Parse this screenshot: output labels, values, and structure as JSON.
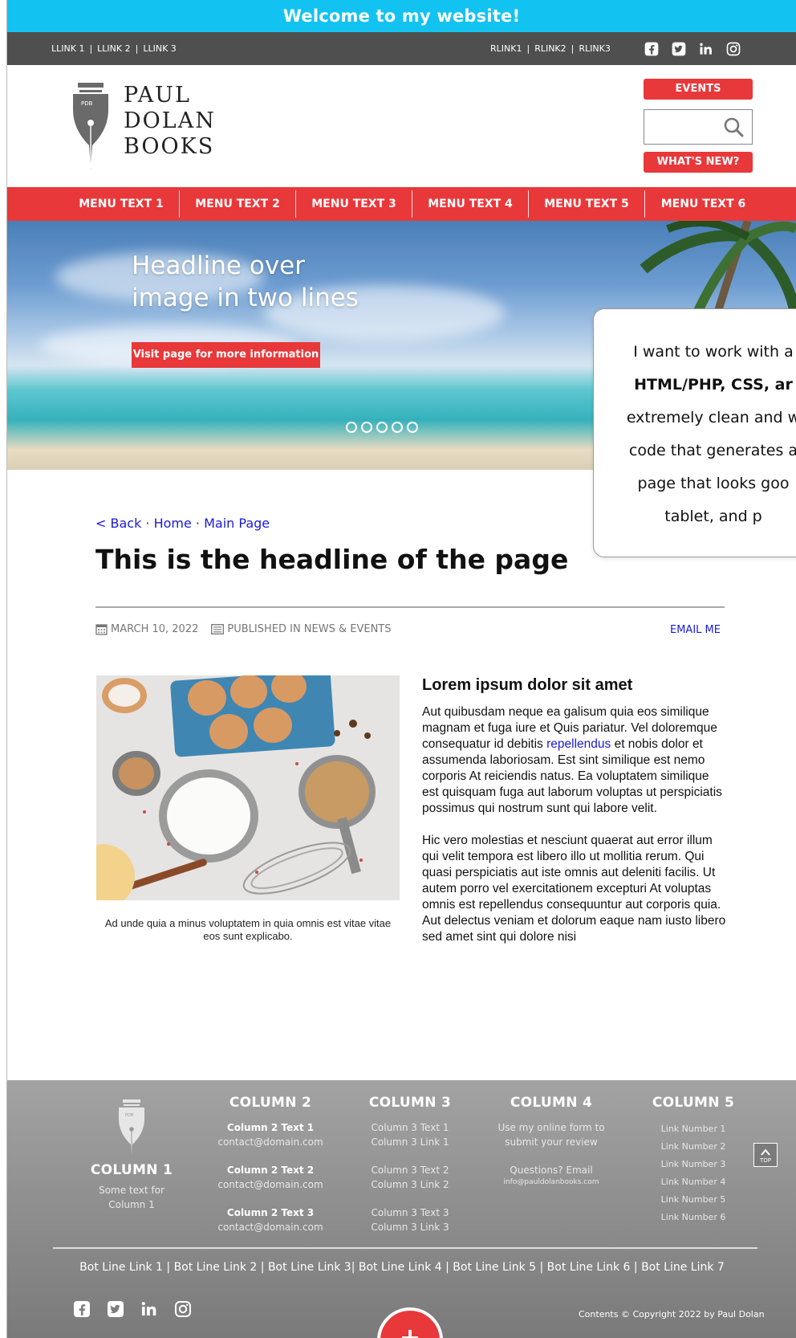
{
  "welcome": {
    "text": "Welcome to my website!"
  },
  "topbar": {
    "left_links": [
      "LLINK 1",
      "LLINK 2",
      "LLINK 3"
    ],
    "right_links": [
      "RLINK1",
      "RLINK2",
      "RLINK3"
    ],
    "separator": "|"
  },
  "header": {
    "logo": {
      "mark_text": "PDB",
      "line1": "PAUL",
      "line2": "DOLAN",
      "line3": "BOOKS"
    },
    "events_label": "EVENTS",
    "whatsnew_label": "WHAT'S NEW?"
  },
  "menu": [
    "MENU TEXT 1",
    "MENU TEXT 2",
    "MENU TEXT 3",
    "MENU TEXT 4",
    "MENU TEXT 5",
    "MENU TEXT 6"
  ],
  "hero": {
    "headline_line1": "Headline over",
    "headline_line2": "image in two lines",
    "button_label": "Visit page for more information",
    "slide_count": 5
  },
  "callout": {
    "line1": "I want to work with a",
    "line2": "HTML/PHP, CSS, ar",
    "line3": "extremely clean and w",
    "line4": "code that generates a",
    "line5": "page that looks goo",
    "line6": "tablet, and p"
  },
  "page": {
    "breadcrumb": "< Back · Home · Main Page",
    "headline": "This is the headline of the page",
    "date": "MARCH 10, 2022",
    "published": "PUBLISHED IN NEWS & EVENTS",
    "email_label": "EMAIL ME"
  },
  "image": {
    "caption": "Ad unde quia a minus voluptatem in quia omnis est vitae vitae eos sunt explicabo."
  },
  "article": {
    "title": "Lorem ipsum dolor sit amet",
    "p1_before": "Aut quibusdam neque ea galisum quia eos similique magnam et fuga iure et Quis pariatur. Vel doloremque consequatur id debitis ",
    "p1_link": "repellendus",
    "p1_after": " et nobis dolor et assumenda laboriosam. Est sint similique est nemo corporis At reiciendis natus. Ea voluptatem similique est quisquam fuga aut laborum voluptas ut perspiciatis possimus qui nostrum sunt qui labore velit.",
    "p2": "Hic vero molestias et nesciunt quaerat aut error illum qui velit tempora est libero illo ut mollitia rerum. Qui quasi perspiciatis aut iste omnis aut deleniti facilis. Ut autem porro vel exercitationem excepturi At voluptas omnis est repellendus consequuntur aut corporis quia. Aut delectus veniam et dolorum eaque nam iusto libero sed amet sint qui dolore nisi"
  },
  "footer": {
    "col1": {
      "mark_text": "PDB",
      "title": "COLUMN 1",
      "text_line1": "Some text for",
      "text_line2": "Column 1"
    },
    "col2": {
      "title": "COLUMN 2",
      "items": [
        {
          "label": "Column 2 Text 1",
          "email": "contact@domain.com"
        },
        {
          "label": "Column 2 Text 2",
          "email": "contact@domain.com"
        },
        {
          "label": "Column 2 Text 3",
          "email": "contact@domain.com"
        }
      ]
    },
    "col3": {
      "title": "COLUMN 3",
      "items": [
        {
          "text": "Column 3 Text 1",
          "link": "Column 3 Link 1"
        },
        {
          "text": "Column 3 Text 2",
          "link": "Column 3 Link 2"
        },
        {
          "text": "Column 3 Text 3",
          "link": "Column 3 Link 3"
        }
      ]
    },
    "col4": {
      "title": "COLUMN 4",
      "line1": "Use my online form to",
      "line2": "submit your review",
      "line3": "Questions? Email",
      "email": "info@pauldolanbooks.com"
    },
    "col5": {
      "title": "COLUMN 5",
      "links": [
        "Link Number 1",
        "Link Number 2",
        "Link Number 3",
        "Link Number 4",
        "Link Number 5",
        "Link Number 6"
      ]
    },
    "top_label": "TOP",
    "bottom_links": [
      "Bot Line Link 1",
      "Bot Line Link 2",
      "Bot Line Link 3",
      "Bot Line Link 4",
      "Bot Line Link 5",
      "Bot Line Link 6",
      "Bot Line Link 7"
    ],
    "copyright": "Contents © Copyright 2022 by Paul Dolan"
  },
  "icons": {
    "social": [
      "facebook-icon",
      "twitter-icon",
      "linkedin-icon",
      "instagram-icon"
    ],
    "search": "search-icon",
    "calendar": "calendar-icon",
    "category": "category-icon"
  },
  "colors": {
    "accent_red": "#e8383a",
    "welcome_blue": "#12c3f1",
    "topbar_gray": "#4f4f4f",
    "link_blue": "#1a1ad6",
    "footer_gray": "#8a8a8a"
  }
}
